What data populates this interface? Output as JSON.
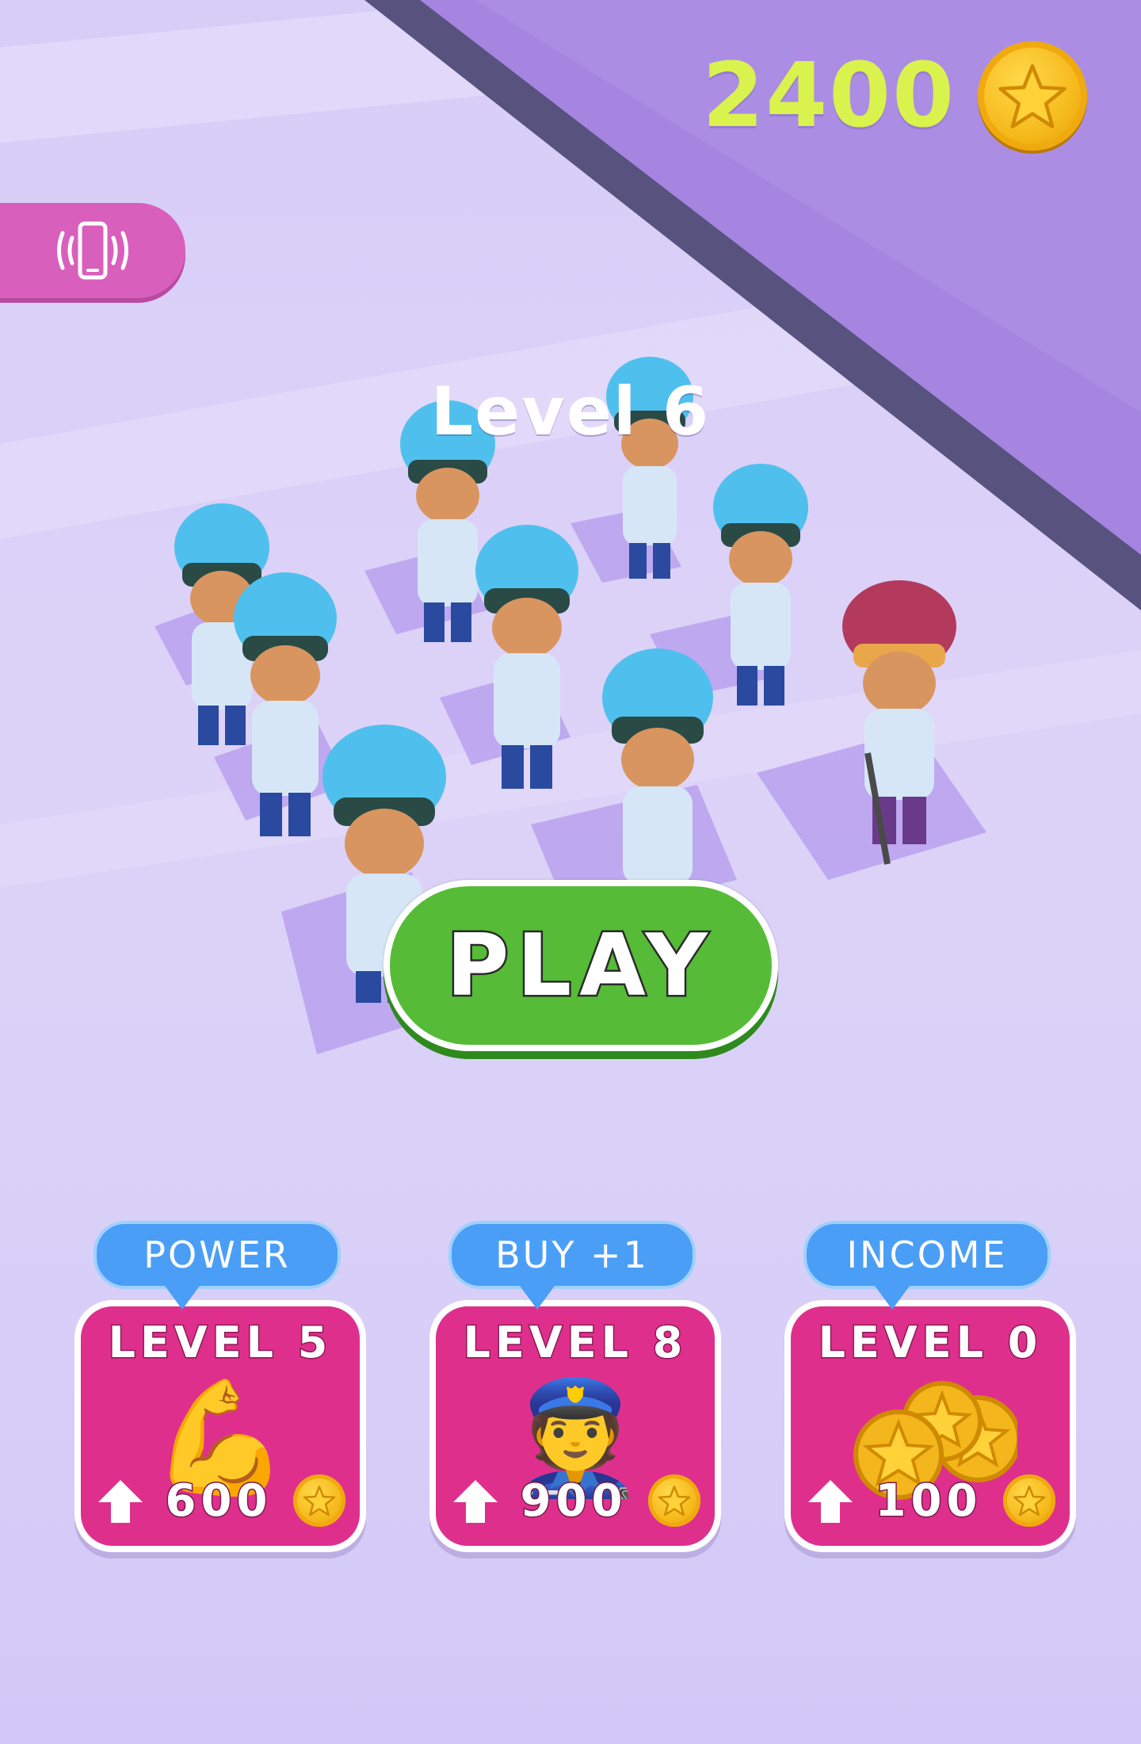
{
  "hud": {
    "coins": "2400",
    "coin_icon": "star-coin-icon",
    "vibration_icon": "phone-vibrate-icon"
  },
  "level": {
    "title": "Level 6"
  },
  "play": {
    "label": "PLAY"
  },
  "upgrades": [
    {
      "tag": "POWER",
      "level": "LEVEL 5",
      "icon": "flexed-biceps-icon",
      "art": "💪",
      "price": "600"
    },
    {
      "tag": "BUY +1",
      "level": "LEVEL 8",
      "icon": "police-officer-icon",
      "art": "👮",
      "price": "900"
    },
    {
      "tag": "INCOME",
      "level": "LEVEL 0",
      "icon": "gold-coins-icon",
      "art": "",
      "price": "100"
    }
  ],
  "colors": {
    "coin_text": "#d9f24d",
    "play_green": "#56bb36",
    "card_pink": "#df2f8c",
    "tag_blue": "#4a9ef6",
    "vibrate_pink": "#d95fbd",
    "road_purple": "#a585e0"
  }
}
